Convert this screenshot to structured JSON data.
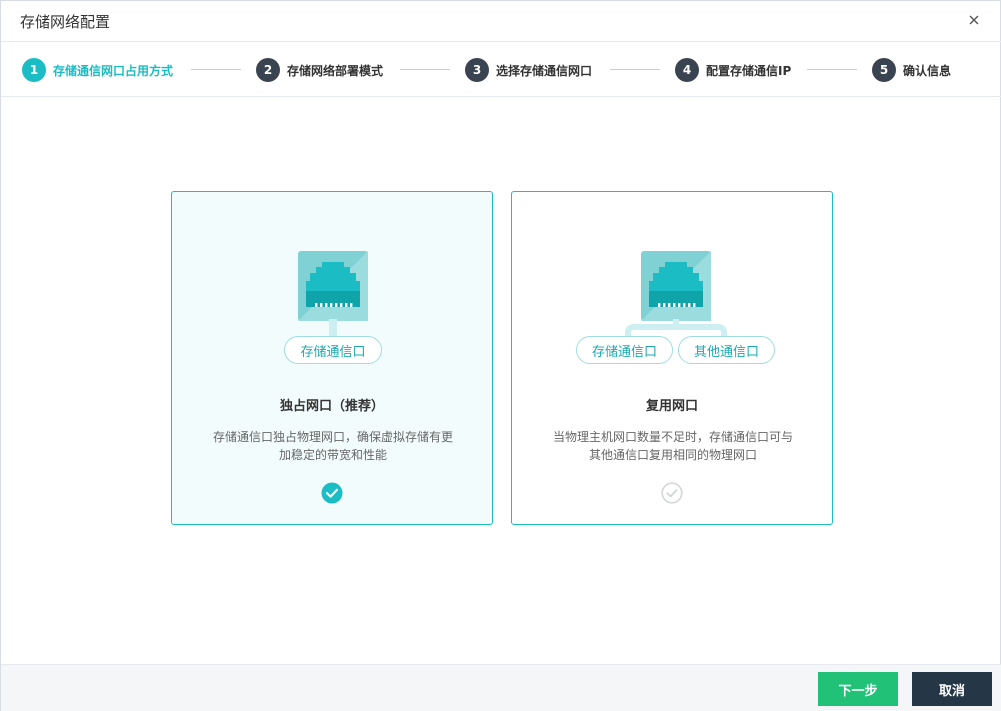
{
  "dialog": {
    "title": "存储网络配置",
    "close_icon": "close-icon"
  },
  "steps": [
    {
      "num": "1",
      "label": "存储通信网口占用方式",
      "active": true
    },
    {
      "num": "2",
      "label": "存储网络部署模式",
      "active": false
    },
    {
      "num": "3",
      "label": "选择存储通信网口",
      "active": false
    },
    {
      "num": "4",
      "label": "配置存储通信IP",
      "active": false
    },
    {
      "num": "5",
      "label": "确认信息",
      "active": false
    }
  ],
  "options": [
    {
      "title": "独占网口（推荐）",
      "desc": "存储通信口独占物理网口，确保虚拟存储有更加稳定的带宽和性能",
      "tags": [
        "存储通信口"
      ],
      "selected": true,
      "icon": "ethernet-port-icon"
    },
    {
      "title": "复用网口",
      "desc": "当物理主机网口数量不足时，存储通信口可与其他通信口复用相同的物理网口",
      "tags": [
        "存储通信口",
        "其他通信口"
      ],
      "selected": false,
      "icon": "ethernet-port-icon"
    }
  ],
  "footer": {
    "next_label": "下一步",
    "cancel_label": "取消"
  },
  "colors": {
    "accent": "#1bbcc4",
    "next_button": "#21c277",
    "cancel_button": "#253746",
    "step_inactive": "#3a4450"
  }
}
